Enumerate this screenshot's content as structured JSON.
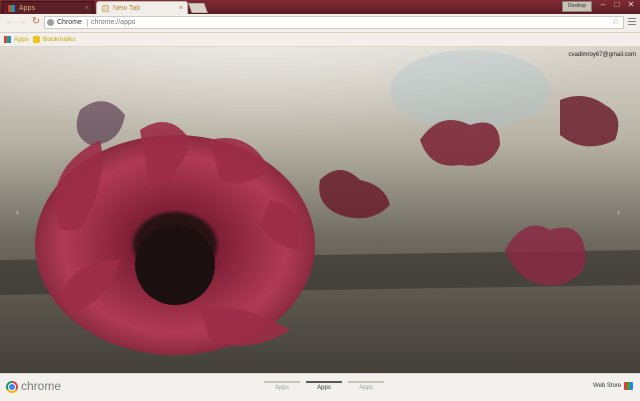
{
  "tabs": [
    {
      "label": "Apps"
    },
    {
      "label": "New Tab"
    }
  ],
  "window": {
    "user_label": "Desktop",
    "min": "–",
    "max": "□",
    "close": "✕"
  },
  "toolbar": {
    "back": "←",
    "forward": "→",
    "reload": "↻",
    "site_chip": "Chrome",
    "url": "chrome://apps",
    "star": "☆"
  },
  "bookmarks_bar": [
    {
      "label": "Apps"
    },
    {
      "label": "Bookmarks"
    }
  ],
  "account": {
    "email": "cvadimroy67@gmail.com"
  },
  "nav": {
    "prev": "‹",
    "next": "›"
  },
  "footer": {
    "brand": "chrome",
    "tabs": [
      "Apps",
      "Apps",
      "Apps"
    ],
    "active_index": 1,
    "webstore": "Web Store"
  },
  "colors": {
    "titlebar": "#6d2430",
    "accent_flower": "#9b2a45",
    "footer_bg": "#f3f1ee"
  }
}
